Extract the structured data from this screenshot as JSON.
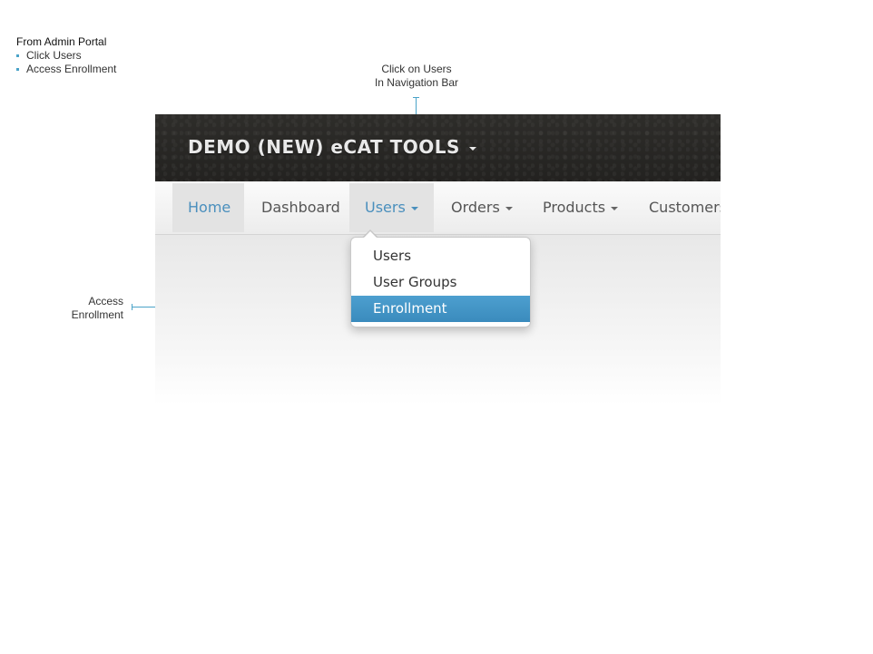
{
  "instructions": {
    "title": "From Admin Portal",
    "steps": [
      "Click Users",
      "Access Enrollment"
    ]
  },
  "annotations": {
    "top_line1": "Click on Users",
    "top_line2": "In Navigation Bar",
    "left_line1": "Access",
    "left_line2": "Enrollment"
  },
  "app": {
    "brand": "DEMO (NEW) eCAT TOOLS"
  },
  "nav": {
    "items": [
      "Home",
      "Dashboard",
      "Users",
      "Orders",
      "Products",
      "Customers"
    ],
    "active": "Home",
    "open_menu": "Users"
  },
  "dropdown": {
    "items": [
      "Users",
      "User Groups",
      "Enrollment"
    ],
    "highlighted": "Enrollment"
  },
  "colors": {
    "accent": "#4aa3c8",
    "highlight": "#4295c7",
    "brandbar": "#2a2927"
  }
}
